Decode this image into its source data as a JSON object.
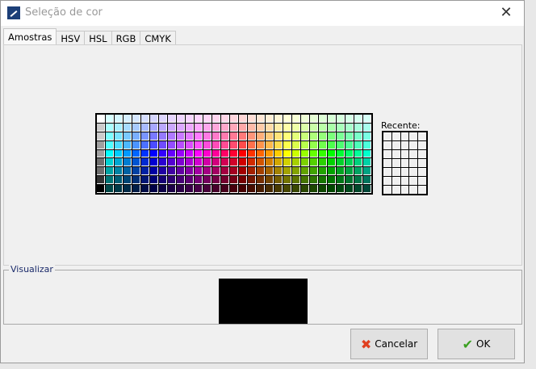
{
  "window": {
    "title": "Seleção de cor"
  },
  "tabs": [
    {
      "label": "Amostras"
    },
    {
      "label": "HSV"
    },
    {
      "label": "HSL"
    },
    {
      "label": "RGB"
    },
    {
      "label": "CMYK"
    }
  ],
  "swatches": {
    "columns": 31,
    "rows": 9,
    "recent_label": "Recente:",
    "recent_columns": 5,
    "recent_rows": 7
  },
  "preview": {
    "label": "Visualizar",
    "color": "#000000"
  },
  "buttons": {
    "cancel": "Cancelar",
    "ok": "OK"
  }
}
